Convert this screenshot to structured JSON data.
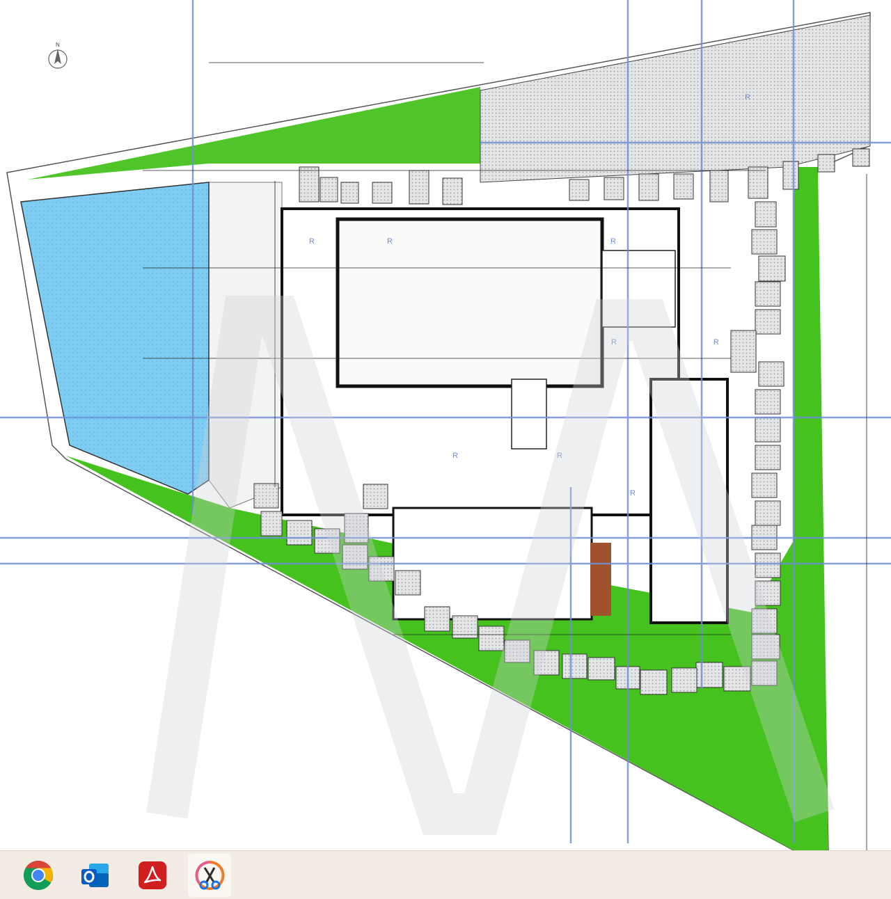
{
  "window": {
    "content": "architectural floor plan drawing",
    "colors": {
      "garden": "#3bbf1c",
      "garden_light": "#7ed957",
      "pool": "#78c9f2",
      "paving": "#d9dadb",
      "wall": "#111111",
      "gridline": "#6f8fd6",
      "stair_wood": "#a0522d"
    },
    "north_label": "N",
    "room_tags": [
      "R",
      "R",
      "R",
      "R",
      "R",
      "R",
      "R",
      "R",
      "R"
    ]
  },
  "taskbar": {
    "apps": [
      {
        "icon": "chrome-icon",
        "label": "Google Chrome",
        "active": false
      },
      {
        "icon": "outlook-icon",
        "label": "Outlook",
        "active": false
      },
      {
        "icon": "acrobat-icon",
        "label": "Adobe Acrobat",
        "active": false
      },
      {
        "icon": "snipping-tool-icon",
        "label": "Snipping Tool",
        "active": true
      }
    ]
  }
}
